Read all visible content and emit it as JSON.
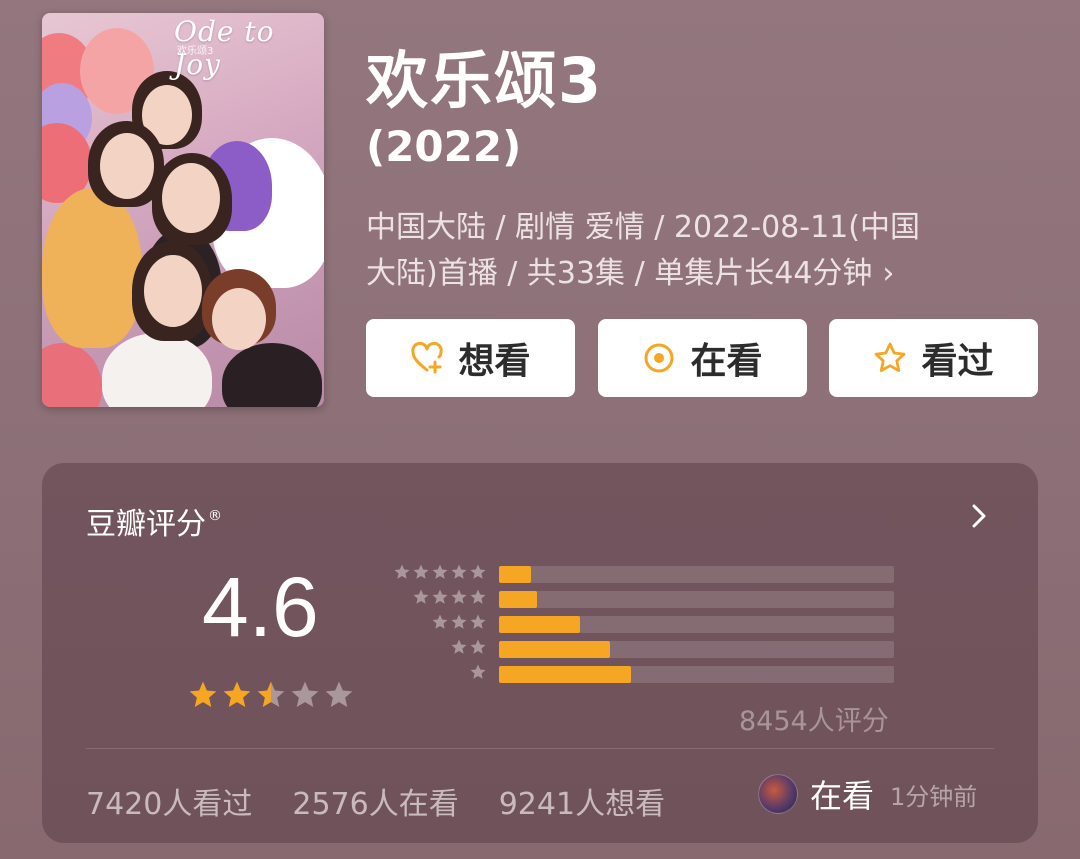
{
  "poster": {
    "title_text": "Ode to Joy",
    "subtitle_text": "欢乐颂3"
  },
  "title": "欢乐颂3",
  "year": "(2022)",
  "meta": {
    "line1": "中国大陆 / 剧情 爱情 / 2022-08-11(中国",
    "line2": "大陆)首播 / 共33集 / 单集片长44分钟"
  },
  "actions": {
    "want_label": "想看",
    "watching_label": "在看",
    "watched_label": "看过"
  },
  "rating": {
    "label": "豆瓣评分",
    "registered_mark": "®",
    "score": "4.6",
    "score_stars": 2.5,
    "distribution": [
      {
        "stars": 5,
        "fraction": 0.08
      },
      {
        "stars": 4,
        "fraction": 0.095
      },
      {
        "stars": 3,
        "fraction": 0.205
      },
      {
        "stars": 2,
        "fraction": 0.28
      },
      {
        "stars": 1,
        "fraction": 0.335
      }
    ],
    "count_text": "8454人评分"
  },
  "stats": {
    "watched": "7420人看过",
    "watching": "2576人在看",
    "want": "9241人想看"
  },
  "activity": {
    "status": "在看",
    "time": "1分钟前"
  },
  "colors": {
    "accent": "#f5a623",
    "background": "#8f727a",
    "card": "#5c4048"
  }
}
